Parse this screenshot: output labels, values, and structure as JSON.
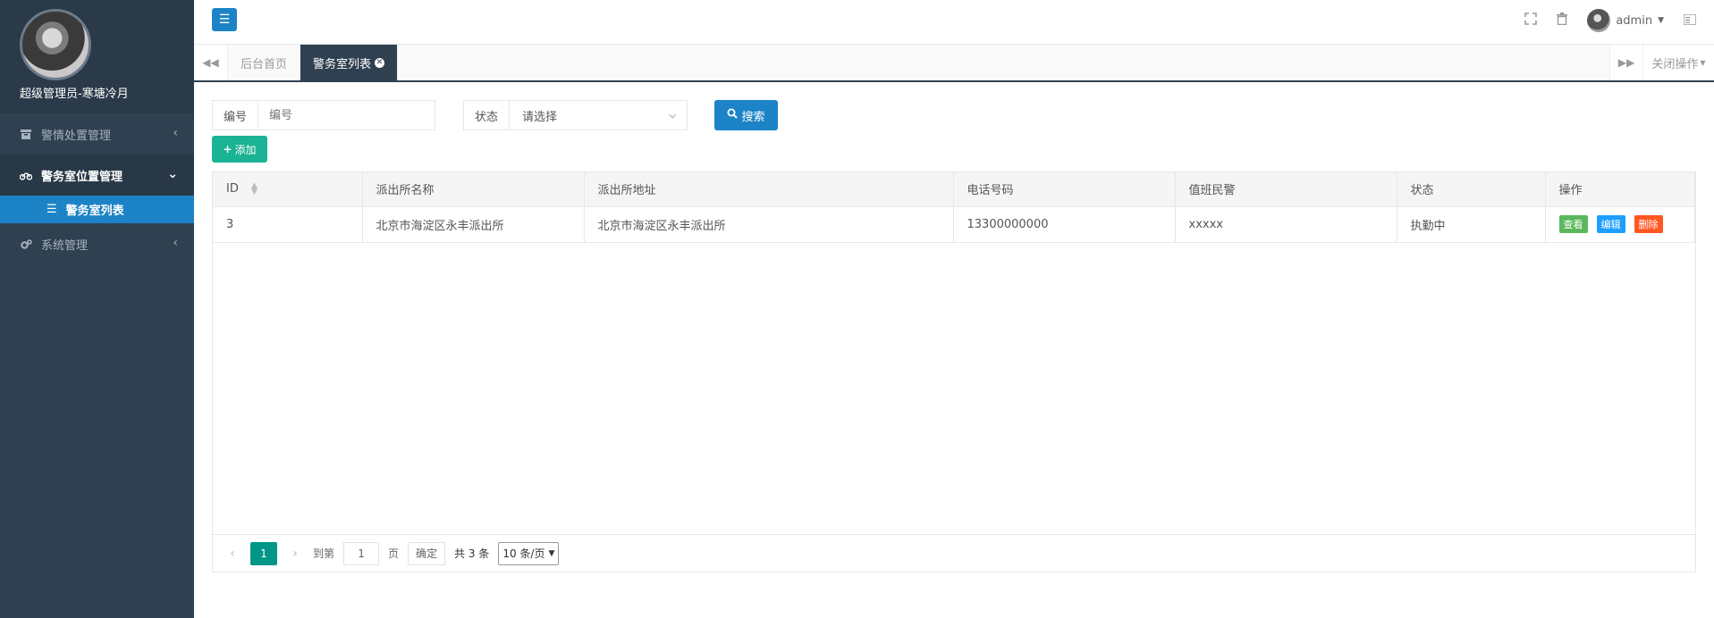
{
  "sidebar": {
    "profile_name": "超级管理员-寒塘冷月",
    "items": [
      {
        "label": "警情处置管理",
        "icon": "archive-icon",
        "expanded": false
      },
      {
        "label": "警务室位置管理",
        "icon": "motorcycle-icon",
        "expanded": true,
        "children": [
          {
            "label": "警务室列表",
            "icon": "list-icon"
          }
        ]
      },
      {
        "label": "系统管理",
        "icon": "gears-icon",
        "expanded": false
      }
    ]
  },
  "topbar": {
    "username": "admin"
  },
  "tabs": {
    "items": [
      {
        "label": "后台首页"
      },
      {
        "label": "警务室列表"
      }
    ],
    "close_ops_label": "关闭操作"
  },
  "search": {
    "code_label": "编号",
    "code_placeholder": "编号",
    "status_label": "状态",
    "status_selected": "请选择",
    "search_button": "搜索",
    "add_button": "添加"
  },
  "table": {
    "columns": [
      "ID",
      "派出所名称",
      "派出所地址",
      "电话号码",
      "值班民警",
      "状态",
      "操作"
    ],
    "rows": [
      {
        "id": "3",
        "name": "北京市海淀区永丰派出所",
        "address": "北京市海淀区永丰派出所",
        "phone": "13300000000",
        "officer": "xxxxx",
        "status": "执勤中"
      }
    ],
    "actions": {
      "view": "查看",
      "edit": "编辑",
      "delete": "删除"
    }
  },
  "pager": {
    "current_page": "1",
    "goto_label": "到第",
    "goto_value": "1",
    "page_unit": "页",
    "confirm": "确定",
    "total": "共 3 条",
    "page_size": "10 条/页"
  },
  "colors": {
    "sidebar_bg": "#2f4050",
    "primary": "#1c84c6",
    "success": "#1ab394",
    "pager_current": "#009688"
  }
}
